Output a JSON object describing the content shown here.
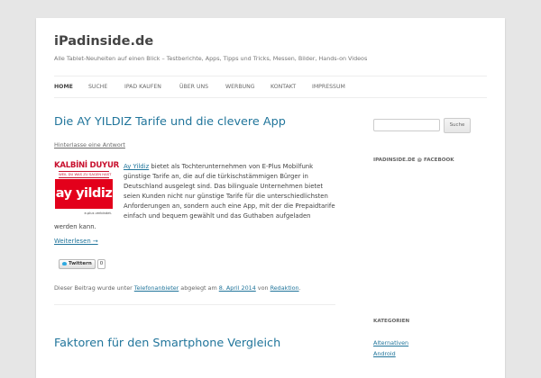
{
  "site": {
    "title": "iPadinside.de",
    "description": "Alle Tablet-Neuheiten auf einen Blick – Testberichte, Apps, Tipps und Tricks, Messen, Bilder, Hands-on Videos"
  },
  "nav": {
    "items": [
      {
        "label": "Home"
      },
      {
        "label": "Suche"
      },
      {
        "label": "iPad kaufen"
      },
      {
        "label": "Über uns"
      },
      {
        "label": "Werbung"
      },
      {
        "label": "Kontakt"
      },
      {
        "label": "Impressum"
      }
    ]
  },
  "post1": {
    "title": "Die AY YILDIZ Tarife und die clevere App",
    "comment_link": "Hinterlasse eine Antwort",
    "thumbnail": {
      "top": "KALBİNİ DUYUR",
      "sub": "WEIL DU WAS ZU SAGEN HAST",
      "brand": "ay yildiz",
      "eplus": "e-plus verbindet."
    },
    "excerpt_link": "Ay Yildiz",
    "excerpt_text": " bietet als Tochterunternehmen von E-Plus Mobilfunk günstige Tarife an, die auf die türkischstämmigen Bürger in Deutschland ausgelegt sind. Das bilinguale Unternehmen bietet seien Kunden nicht nur günstige Tarife für die unterschiedlichsten Anforderungen an, sondern auch eine App, mit der die Prepaidtarife einfach und bequem gewählt und das Guthaben aufgeladen werden kann.",
    "read_more": "Weiterlesen →",
    "tweet": {
      "label": "Twittern",
      "count": "0"
    },
    "meta": {
      "prefix": "Dieser Beitrag wurde unter ",
      "category": "Telefonanbieter",
      "middle": " abgelegt am ",
      "date": "8. April 2014",
      "by": " von ",
      "author": "Redaktion",
      "suffix": "."
    }
  },
  "post2": {
    "title": "Faktoren für den Smartphone Vergleich"
  },
  "sidebar": {
    "search_button": "Suche",
    "facebook_title": "iPadinside.de @ Facebook",
    "categories_title": "Kategorien",
    "categories": [
      "Alternativen",
      "Android"
    ]
  },
  "colors": {
    "link": "#21759b",
    "background": "#e6e6e6",
    "brand_red": "#e3001b"
  }
}
